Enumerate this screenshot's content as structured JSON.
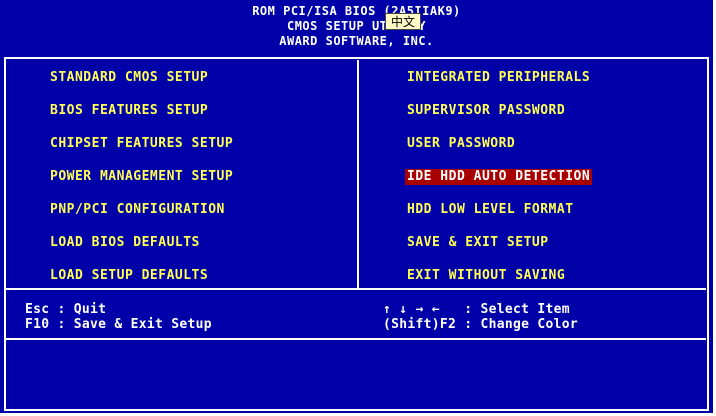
{
  "header": {
    "line1": "ROM PCI/ISA BIOS (2A5IIAK9)",
    "line2": "CMOS SETUP UTILITY",
    "line3": "AWARD SOFTWARE, INC."
  },
  "ime_indicator": "中文",
  "menu": {
    "left": [
      "STANDARD CMOS SETUP",
      "BIOS FEATURES SETUP",
      "CHIPSET FEATURES SETUP",
      "POWER MANAGEMENT SETUP",
      "PNP/PCI CONFIGURATION",
      "LOAD BIOS DEFAULTS",
      "LOAD SETUP DEFAULTS"
    ],
    "right": [
      "INTEGRATED PERIPHERALS",
      "SUPERVISOR PASSWORD",
      "USER PASSWORD",
      "IDE HDD AUTO DETECTION",
      "HDD LOW LEVEL FORMAT",
      "SAVE & EXIT SETUP",
      "EXIT WITHOUT SAVING"
    ],
    "selected": "IDE HDD AUTO DETECTION"
  },
  "help": {
    "left_line1": "Esc : Quit",
    "left_line2": "F10 : Save & Exit Setup",
    "right_line1": "↑ ↓ → ←   : Select Item",
    "right_line2": "(Shift)F2 : Change Color"
  },
  "colors": {
    "background": "#0000a8",
    "menu_text": "#ffff54",
    "highlight": "#a80000",
    "foreground": "#ffffff"
  }
}
